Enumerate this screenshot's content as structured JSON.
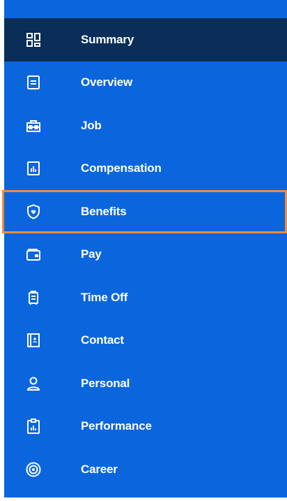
{
  "colors": {
    "panel_background": "#0b66de",
    "active_background": "#0a2e57",
    "highlight_border": "#f08a3c",
    "text": "#ffffff"
  },
  "nav": {
    "items": [
      {
        "label": "Summary",
        "icon": "dashboard-grid-icon",
        "active": true
      },
      {
        "label": "Overview",
        "icon": "document-icon"
      },
      {
        "label": "Job",
        "icon": "toolbox-icon"
      },
      {
        "label": "Compensation",
        "icon": "bar-chart-icon"
      },
      {
        "label": "Benefits",
        "icon": "shield-heart-icon",
        "highlighted": true
      },
      {
        "label": "Pay",
        "icon": "wallet-icon"
      },
      {
        "label": "Time Off",
        "icon": "suitcase-icon"
      },
      {
        "label": "Contact",
        "icon": "contact-card-icon"
      },
      {
        "label": "Personal",
        "icon": "person-icon"
      },
      {
        "label": "Performance",
        "icon": "clipboard-chart-icon"
      },
      {
        "label": "Career",
        "icon": "target-icon"
      }
    ]
  }
}
